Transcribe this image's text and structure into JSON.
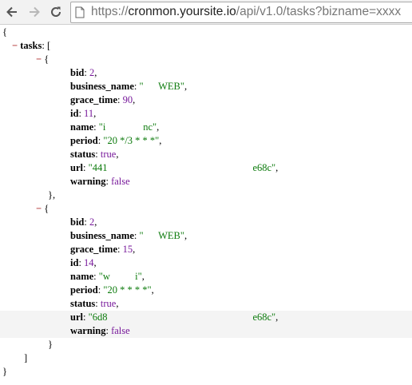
{
  "browser": {
    "url_prefix": "https://",
    "url_host": "cronmon.yoursite.io",
    "url_path": "/api/v1.0/tasks?bizname=xxxx"
  },
  "json": {
    "open_brace": "{",
    "close_brace": "}",
    "root_key": "tasks",
    "tasks": [
      {
        "bid": "2",
        "business_name": "\"      WEB\"",
        "grace_time": "90",
        "id": "11",
        "name": "\"i               nc\"",
        "period": "\"20 */3 * * *\"",
        "status": "true",
        "url": "\"441",
        "url_tail": "e68c\"",
        "warning": "false"
      },
      {
        "bid": "2",
        "business_name": "\"      WEB\"",
        "grace_time": "15",
        "id": "14",
        "name": "\"w          i\"",
        "period": "\"20 * * * *\"",
        "status": "true",
        "url": "\"6d8",
        "url_tail": "e68c\"",
        "warning": "false"
      }
    ]
  }
}
